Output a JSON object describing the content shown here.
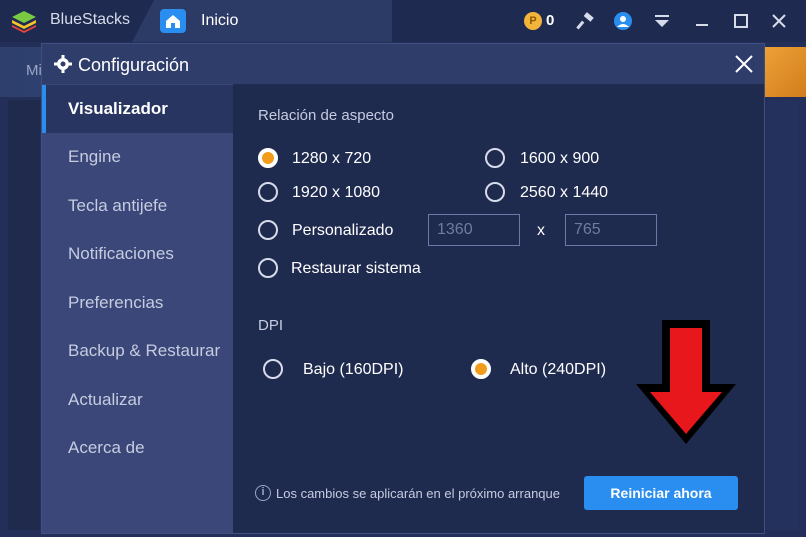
{
  "app": {
    "name": "BlueStacks",
    "tab_label": "Inicio",
    "coins": "0",
    "coin_symbol": "P"
  },
  "background": {
    "banner_text": "Mi"
  },
  "dialog": {
    "title": "Configuración",
    "nav": [
      {
        "label": "Visualizador",
        "active": true
      },
      {
        "label": "Engine"
      },
      {
        "label": "Tecla antijefe"
      },
      {
        "label": "Notificaciones"
      },
      {
        "label": "Preferencias"
      },
      {
        "label": "Backup & Restaurar"
      },
      {
        "label": "Actualizar"
      },
      {
        "label": "Acerca de"
      }
    ],
    "aspect": {
      "title": "Relación de aspecto",
      "options": [
        {
          "label": "1280 x 720",
          "checked": true
        },
        {
          "label": "1600 x 900"
        },
        {
          "label": "1920 x 1080"
        },
        {
          "label": "2560 x 1440"
        },
        {
          "label": "Personalizado"
        },
        {
          "label": "Restaurar sistema"
        }
      ],
      "custom_width_placeholder": "1360",
      "custom_height_placeholder": "765",
      "separator": "x"
    },
    "dpi": {
      "title": "DPI",
      "options": [
        {
          "label": "Bajo (160DPI)"
        },
        {
          "label": "Alto (240DPI)",
          "checked": true
        }
      ]
    },
    "footer": {
      "info_symbol": "i",
      "info_text": "Los cambios se aplicarán en el próximo arranque",
      "restart_label": "Reiniciar ahora"
    }
  },
  "colors": {
    "accent": "#2a8ef0",
    "radio_checked": "#f39b1a",
    "arrow": "#e8171c"
  }
}
